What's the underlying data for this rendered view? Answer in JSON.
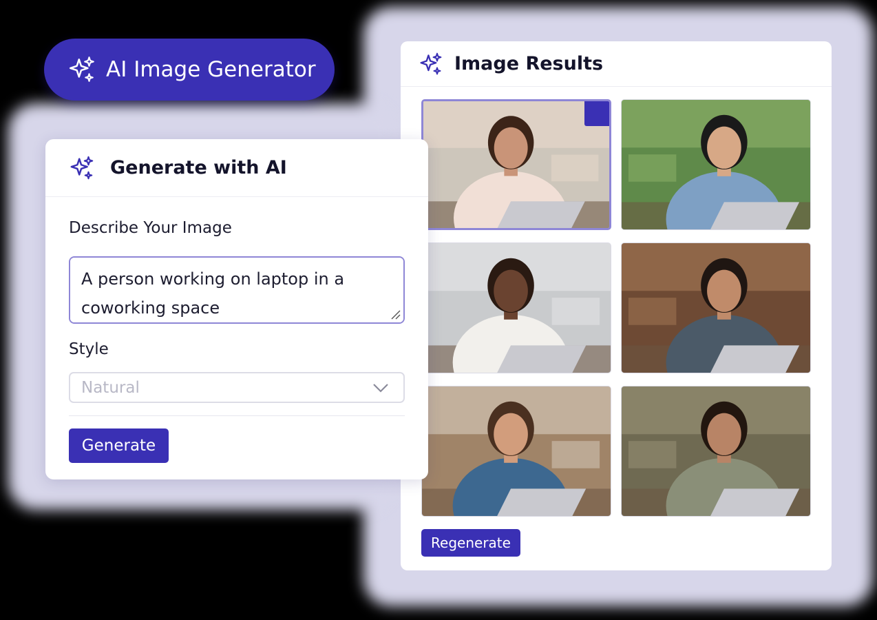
{
  "badge": {
    "label": "AI Image Generator",
    "icon": "sparkles-icon"
  },
  "results_panel": {
    "title": "Image Results",
    "icon": "sparkles-icon",
    "selected_index": 0,
    "images": [
      {
        "name": "woman-curly-hair-laptop",
        "bg": "#cdc6bb",
        "accent": "#e9d9cc",
        "skin": "#c99478",
        "hair": "#3c2418",
        "shirt": "#f1dfd6"
      },
      {
        "name": "man-blue-shirt-green-wall",
        "bg": "#5f8a4a",
        "accent": "#8fb36a",
        "skin": "#d7a886",
        "hair": "#1a1a1a",
        "shirt": "#7ea0c4"
      },
      {
        "name": "woman-braids-white-blouse",
        "bg": "#c9cbcd",
        "accent": "#e8e8ea",
        "skin": "#6a4330",
        "hair": "#2a1a12",
        "shirt": "#f2f0ec"
      },
      {
        "name": "man-beard-denim-shirt",
        "bg": "#6e4a34",
        "accent": "#a57a56",
        "skin": "#c08b6a",
        "hair": "#1f1612",
        "shirt": "#4b5a68"
      },
      {
        "name": "man-denim-jacket-laptop",
        "bg": "#a08468",
        "accent": "#d8cdbf",
        "skin": "#d29d7c",
        "hair": "#4a3020",
        "shirt": "#3d6890"
      },
      {
        "name": "woman-olive-shirt-laptop",
        "bg": "#6f6a52",
        "accent": "#9b9478",
        "skin": "#b88466",
        "hair": "#22160f",
        "shirt": "#8a8f78"
      }
    ],
    "regenerate_label": "Regenerate"
  },
  "generate_panel": {
    "title": "Generate with AI",
    "icon": "sparkles-icon",
    "prompt_label": "Describe Your Image",
    "prompt_value": "A person working on laptop in a coworking space",
    "style_label": "Style",
    "style_placeholder": "Natural",
    "generate_label": "Generate"
  },
  "colors": {
    "brand": "#3a30b4",
    "focus_border": "#8e86d6"
  }
}
